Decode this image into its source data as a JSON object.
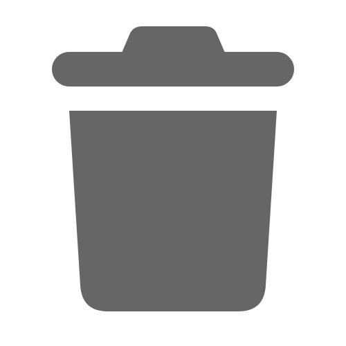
{
  "icon": {
    "name": "trash-icon",
    "color": "#666666",
    "background": "#ffffff"
  }
}
